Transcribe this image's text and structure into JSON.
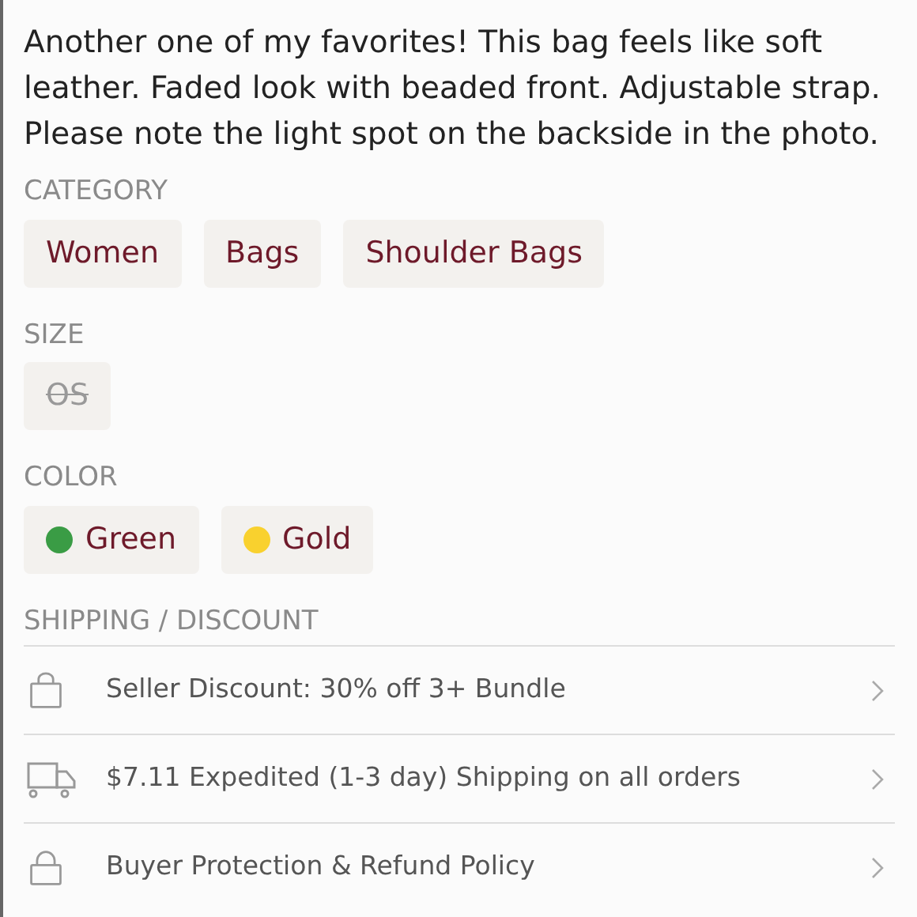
{
  "description": "Another one of my favorites! This bag feels like soft leather. Faded look with beaded front. Adjustable strap. Please note the light spot on the backside in the photo.",
  "category": {
    "heading": "CATEGORY",
    "items": [
      {
        "label": "Women"
      },
      {
        "label": "Bags"
      },
      {
        "label": "Shoulder Bags"
      }
    ]
  },
  "size": {
    "heading": "SIZE",
    "items": [
      {
        "label": "OS",
        "disabled": true
      }
    ]
  },
  "color": {
    "heading": "COLOR",
    "items": [
      {
        "label": "Green",
        "color": "#3a9c45"
      },
      {
        "label": "Gold",
        "color": "#f9d12e"
      }
    ]
  },
  "shipping": {
    "heading": "SHIPPING / DISCOUNT",
    "rows": [
      {
        "kind": "bag",
        "label": "Seller Discount: 30% off 3+ Bundle"
      },
      {
        "kind": "truck",
        "label": "$7.11 Expedited (1-3 day) Shipping on all orders"
      },
      {
        "kind": "lock",
        "label": "Buyer Protection & Refund Policy"
      }
    ]
  }
}
